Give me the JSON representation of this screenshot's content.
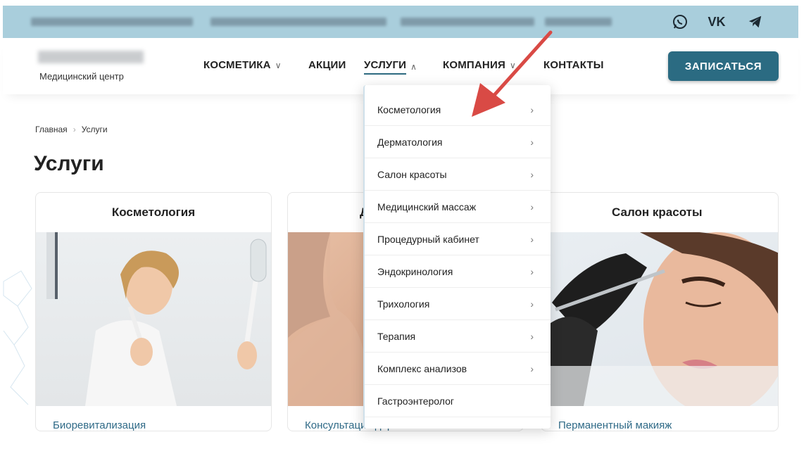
{
  "social": {
    "whatsapp": "whatsapp-icon",
    "vk_label": "VK",
    "telegram": "telegram-icon"
  },
  "logo": {
    "subtitle": "Медицинский центр"
  },
  "nav": [
    {
      "label": "КОСМЕТИКА",
      "chev": "∨"
    },
    {
      "label": "АКЦИИ",
      "chev": ""
    },
    {
      "label": "УСЛУГИ",
      "chev": "∧"
    },
    {
      "label": "КОМПАНИЯ",
      "chev": "∨"
    },
    {
      "label": "КОНТАКТЫ",
      "chev": ""
    }
  ],
  "cta": {
    "label": "ЗАПИСАТЬСЯ"
  },
  "breadcrumb": {
    "home": "Главная",
    "sep": "›",
    "current": "Услуги"
  },
  "page": {
    "title": "Услуги"
  },
  "cards": [
    {
      "title": "Косметология",
      "link": "Биоревитализация"
    },
    {
      "title": "Д",
      "link": "Консультация дерматолога"
    },
    {
      "title": "Салон красоты",
      "link": "Перманентный макияж"
    }
  ],
  "dropdown": {
    "arrow": "›",
    "items": [
      "Косметология",
      "Дерматология",
      "Салон красоты",
      "Медицинский массаж",
      "Процедурный кабинет",
      "Эндокринология",
      "Трихология",
      "Терапия",
      "Комплекс анализов",
      "Гастроэнтеролог"
    ]
  },
  "colors": {
    "accent": "#2b6b82",
    "topbar": "#a9cedc",
    "annotation_arrow": "#d94a45"
  }
}
